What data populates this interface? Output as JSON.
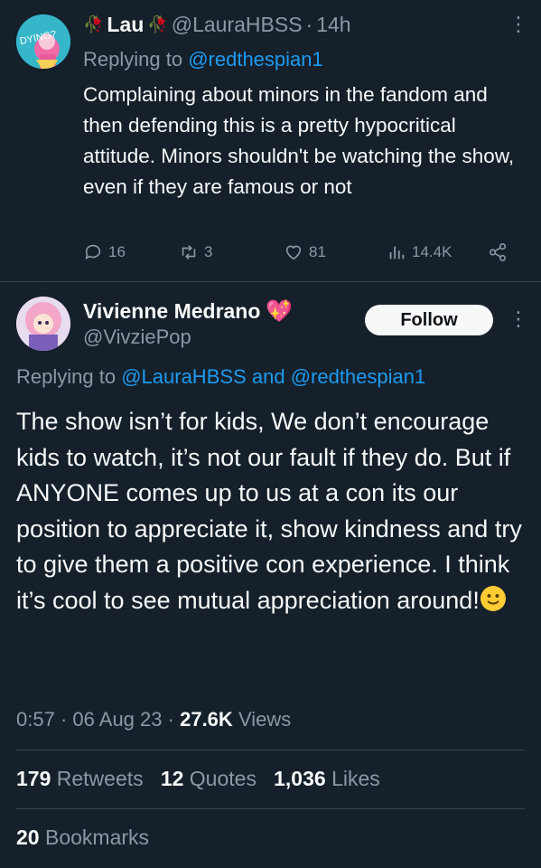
{
  "reply": {
    "name": "Lau",
    "name_icons": [
      "rose-icon",
      "rose-icon"
    ],
    "handle": "@LauraHBSS",
    "time": "14h",
    "avatar_text": "DYING?",
    "replying_prefix": "Replying to",
    "replying_to": "@redthespian1",
    "text": "Complaining about minors in the fandom and then defending this is a pretty hypocritical attitude. Minors shouldn't be watching  the show, even if they are famous or not",
    "replies": "16",
    "retweets": "3",
    "likes": "81",
    "views": "14.4K"
  },
  "main": {
    "name": "Vivienne Medrano",
    "badge_icon": "sparkling-heart-icon",
    "handle": "@VivziePop",
    "follow_label": "Follow",
    "replying_prefix": "Replying to",
    "replying_to_1": "@LauraHBSS",
    "replying_and": "and",
    "replying_to_2": "@redthespian1",
    "text": "The show isn’t for kids, We don’t encourage kids to watch, it’s not our fault if they do. But if ANYONE comes up to us at a con its our position to appreciate it, show kindness and try to give them a positive con experience. I  think it’s cool to see mutual appreciation around!",
    "time": "0:57",
    "date": "06 Aug 23",
    "views_count": "27.6K",
    "views_label": "Views",
    "retweets_count": "179",
    "retweets_label": "Retweets",
    "quotes_count": "12",
    "quotes_label": "Quotes",
    "likes_count": "1,036",
    "likes_label": "Likes",
    "bookmarks_count": "20",
    "bookmarks_label": "Bookmarks"
  },
  "colors": {
    "background": "#15202b",
    "text": "#f7f9f9",
    "muted": "#8b98a5",
    "link": "#1d9bf0",
    "divider": "#38444d"
  }
}
